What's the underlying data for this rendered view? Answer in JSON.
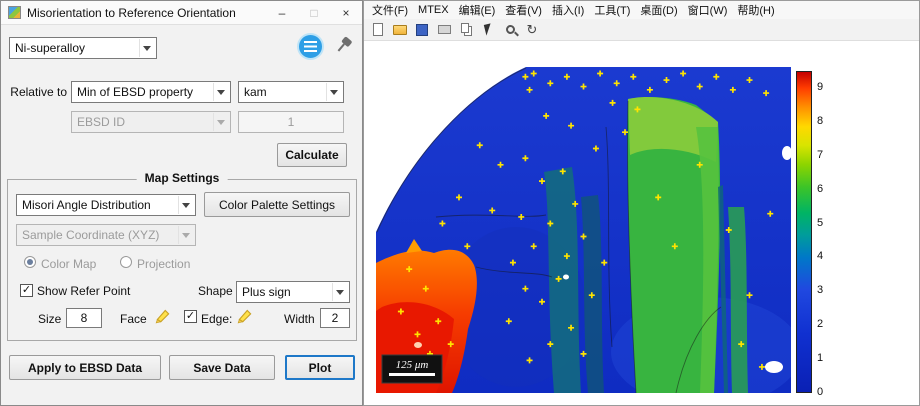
{
  "dialog": {
    "title": "Misorientation to Reference Orientation",
    "window_controls": {
      "minimize": "–",
      "maximize": "□",
      "close": "×"
    },
    "check_glyph": "✓",
    "phase_select": {
      "value": "Ni-superalloy"
    },
    "relative_to": {
      "label": "Relative to",
      "property_select": "Min of EBSD property",
      "metric_select": "kam"
    },
    "ebsd_id": {
      "label": "EBSD ID",
      "value": "1"
    },
    "calculate_button": "Calculate",
    "map_settings": {
      "group_title": "Map Settings",
      "distribution_select": "Misori Angle Distribution",
      "palette_button": "Color Palette Settings",
      "coordinate_select": "Sample Coordinate (XYZ)",
      "color_map_radio": "Color Map",
      "projection_radio": "Projection",
      "show_refer_point_checkbox": "Show Refer Point",
      "shape_label": "Shape",
      "shape_select": "Plus sign",
      "size_label": "Size",
      "size_value": "8",
      "face_label": "Face",
      "edge_checkbox": "Edge:",
      "width_label": "Width",
      "width_value": "2"
    },
    "apply_button": "Apply to EBSD Data",
    "save_button": "Save Data",
    "plot_button": "Plot"
  },
  "figure": {
    "menu_items": [
      "文件(F)",
      "MTEX",
      "编辑(E)",
      "查看(V)",
      "插入(I)",
      "工具(T)",
      "桌面(D)",
      "窗口(W)",
      "帮助(H)"
    ],
    "toolbar_icons": [
      "new-file-icon",
      "open-folder-icon",
      "save-icon",
      "print-icon",
      "copy-icon",
      "cursor-icon",
      "zoom-in-icon",
      "rotate-icon"
    ],
    "scale_bar_label": "125 μm",
    "colorbar": {
      "max": 9.5,
      "ticks": [
        9,
        8,
        7,
        6,
        5,
        4,
        3,
        2,
        1,
        0
      ]
    },
    "markers": [
      [
        36,
        3
      ],
      [
        37,
        7
      ],
      [
        38,
        2
      ],
      [
        42,
        5
      ],
      [
        46,
        3
      ],
      [
        50,
        6
      ],
      [
        54,
        2
      ],
      [
        58,
        5
      ],
      [
        62,
        3
      ],
      [
        66,
        7
      ],
      [
        70,
        4
      ],
      [
        74,
        2
      ],
      [
        78,
        6
      ],
      [
        82,
        3
      ],
      [
        86,
        7
      ],
      [
        90,
        4
      ],
      [
        94,
        8
      ],
      [
        57,
        11
      ],
      [
        63,
        13
      ],
      [
        60,
        20
      ],
      [
        53,
        25
      ],
      [
        47,
        18
      ],
      [
        41,
        15
      ],
      [
        25,
        24
      ],
      [
        30,
        30
      ],
      [
        36,
        28
      ],
      [
        40,
        35
      ],
      [
        45,
        32
      ],
      [
        28,
        44
      ],
      [
        35,
        46
      ],
      [
        42,
        48
      ],
      [
        48,
        42
      ],
      [
        38,
        55
      ],
      [
        33,
        60
      ],
      [
        46,
        58
      ],
      [
        50,
        52
      ],
      [
        55,
        60
      ],
      [
        36,
        68
      ],
      [
        40,
        72
      ],
      [
        44,
        65
      ],
      [
        52,
        70
      ],
      [
        32,
        78
      ],
      [
        47,
        80
      ],
      [
        42,
        85
      ],
      [
        37,
        90
      ],
      [
        50,
        88
      ],
      [
        8,
        62
      ],
      [
        12,
        68
      ],
      [
        6,
        75
      ],
      [
        10,
        82
      ],
      [
        15,
        78
      ],
      [
        5,
        90
      ],
      [
        13,
        88
      ],
      [
        18,
        85
      ],
      [
        20,
        40
      ],
      [
        16,
        48
      ],
      [
        22,
        55
      ],
      [
        68,
        40
      ],
      [
        72,
        55
      ],
      [
        78,
        30
      ],
      [
        85,
        50
      ],
      [
        90,
        70
      ],
      [
        95,
        45
      ],
      [
        88,
        85
      ],
      [
        93,
        92
      ]
    ]
  }
}
